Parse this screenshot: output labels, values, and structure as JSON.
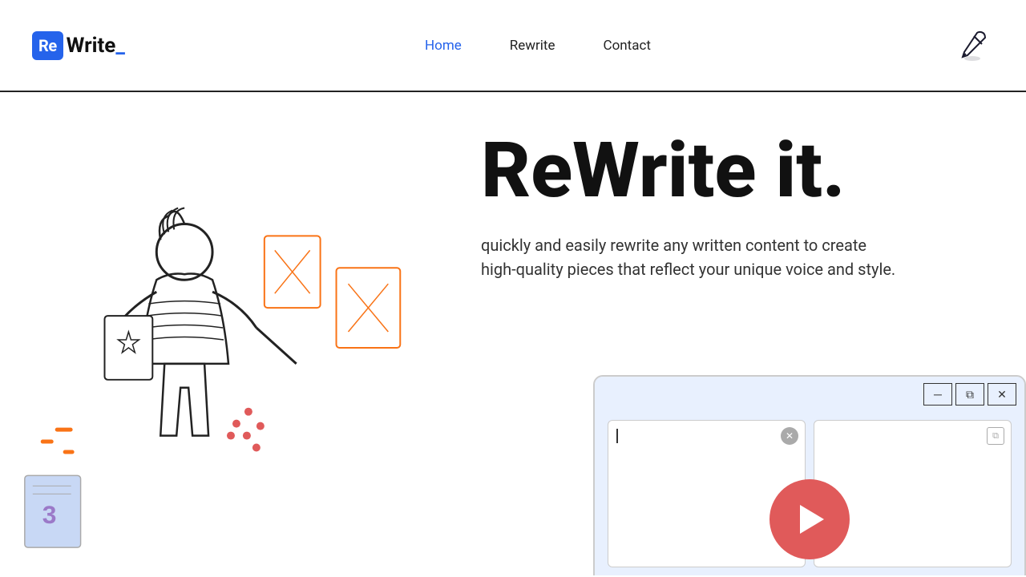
{
  "header": {
    "logo_re": "Re",
    "logo_write": "W",
    "logo_ite": "rite",
    "logo_cursor": "_",
    "nav": {
      "home": "Home",
      "rewrite": "Rewrite",
      "contact": "Contact"
    }
  },
  "hero": {
    "heading": "ReWrite it.",
    "subtext": "quickly and easily rewrite any written content to create high-quality pieces that reflect your unique voice and style."
  },
  "window": {
    "minimize_label": "─",
    "maximize_label": "⧉",
    "close_label": "✕"
  },
  "colors": {
    "blue": "#2563eb",
    "red_play": "#e05a5a",
    "dark": "#111111",
    "light_blue_bg": "#e8f0fe"
  }
}
